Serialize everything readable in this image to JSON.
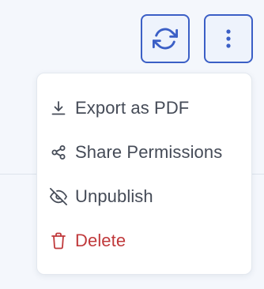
{
  "toolbar": {
    "refresh_icon": "refresh-icon",
    "more_icon": "more-vertical-icon"
  },
  "menu": {
    "items": [
      {
        "label": "Export as PDF",
        "icon": "download-icon"
      },
      {
        "label": "Share Permissions",
        "icon": "share-icon"
      },
      {
        "label": "Unpublish",
        "icon": "eye-off-icon"
      },
      {
        "label": "Delete",
        "icon": "trash-icon"
      }
    ]
  },
  "colors": {
    "accent": "#3b5fc6",
    "text": "#454b57",
    "danger": "#c0393b",
    "background": "#f4f7fc"
  }
}
